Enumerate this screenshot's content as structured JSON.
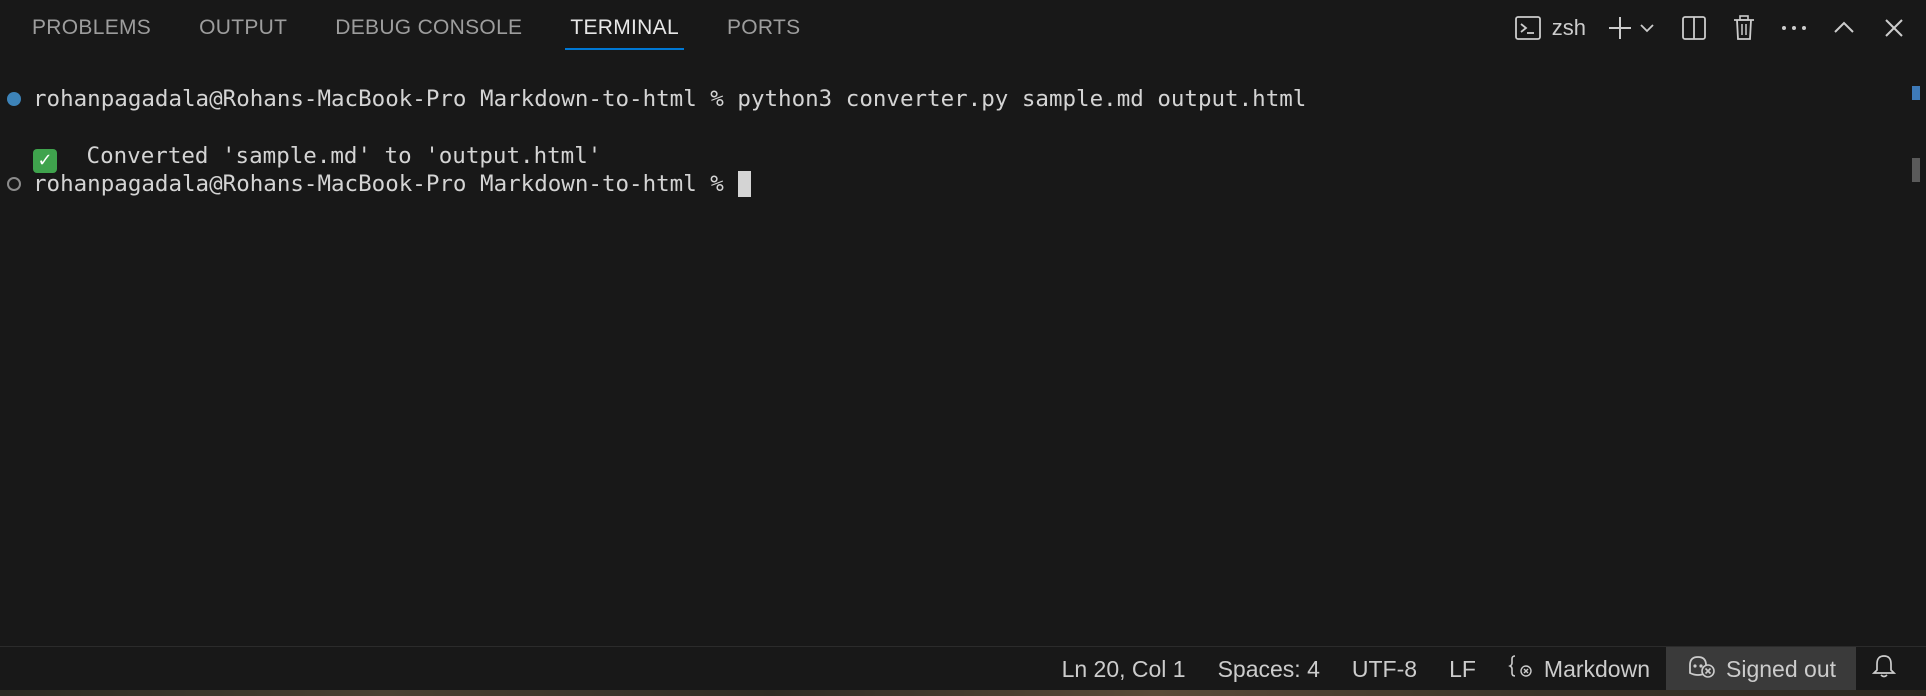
{
  "panel": {
    "tabs": [
      {
        "label": "PROBLEMS"
      },
      {
        "label": "OUTPUT"
      },
      {
        "label": "DEBUG CONSOLE"
      },
      {
        "label": "TERMINAL",
        "active": true
      },
      {
        "label": "PORTS"
      }
    ],
    "terminal_name": "zsh",
    "action_icons": [
      "terminal-icon",
      "plus-icon",
      "chevron-down-icon",
      "split-icon",
      "trash-icon",
      "more-icon",
      "chevron-up-icon",
      "close-icon"
    ]
  },
  "terminal": {
    "lines": [
      {
        "text": "rohanpagadala@Rohans-MacBook-Pro Markdown-to-html % python3 converter.py sample.md output.html",
        "decoration": "success"
      },
      {
        "text": " Converted 'sample.md' to 'output.html'",
        "emoji": "✓"
      },
      {
        "text": "rohanpagadala@Rohans-MacBook-Pro Markdown-to-html %",
        "decoration": "empty",
        "cursor": true
      }
    ],
    "colors": {
      "text": "#d4d4d4",
      "decoration_success": "#3d83b8",
      "check_badge": "#3fa34d"
    }
  },
  "status_bar": {
    "position": "Ln 20, Col 1",
    "indent": "Spaces: 4",
    "encoding": "UTF-8",
    "eol": "LF",
    "language": "Markdown",
    "account": "Signed out",
    "icons": [
      "braces-icon",
      "copilot-signed-out-icon",
      "bell-icon"
    ]
  },
  "theme": {
    "background": "#181818",
    "accent": "#0078d4"
  }
}
